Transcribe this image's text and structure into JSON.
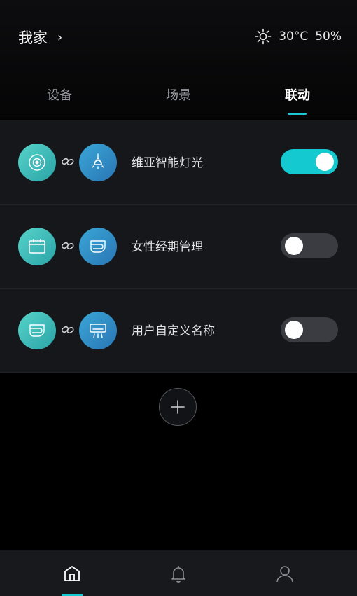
{
  "header": {
    "home_name": "我家",
    "chevron": "›",
    "temperature": "30°C",
    "humidity": "50%",
    "weather_icon": "sun-icon"
  },
  "tabs": [
    {
      "label": "设备",
      "active": false
    },
    {
      "label": "场景",
      "active": false
    },
    {
      "label": "联动",
      "active": true
    }
  ],
  "linkages": [
    {
      "trigger_icon": "sensor-icon",
      "action_icon": "light-bulb-icon",
      "name": "维亚智能灯光",
      "enabled": true
    },
    {
      "trigger_icon": "calendar-icon",
      "action_icon": "toilet-icon",
      "name": "女性经期管理",
      "enabled": false
    },
    {
      "trigger_icon": "toilet-icon",
      "action_icon": "air-conditioner-icon",
      "name": "用户自定义名称",
      "enabled": false
    }
  ],
  "colors": {
    "accent": "#14c9cf",
    "row_bg": "#15171b",
    "teal_icon": "#3fbfbb",
    "blue_icon": "#2f8ac4"
  },
  "bottom_nav": [
    {
      "icon": "home-icon",
      "active": true
    },
    {
      "icon": "bell-icon",
      "active": false
    },
    {
      "icon": "user-icon",
      "active": false
    }
  ]
}
